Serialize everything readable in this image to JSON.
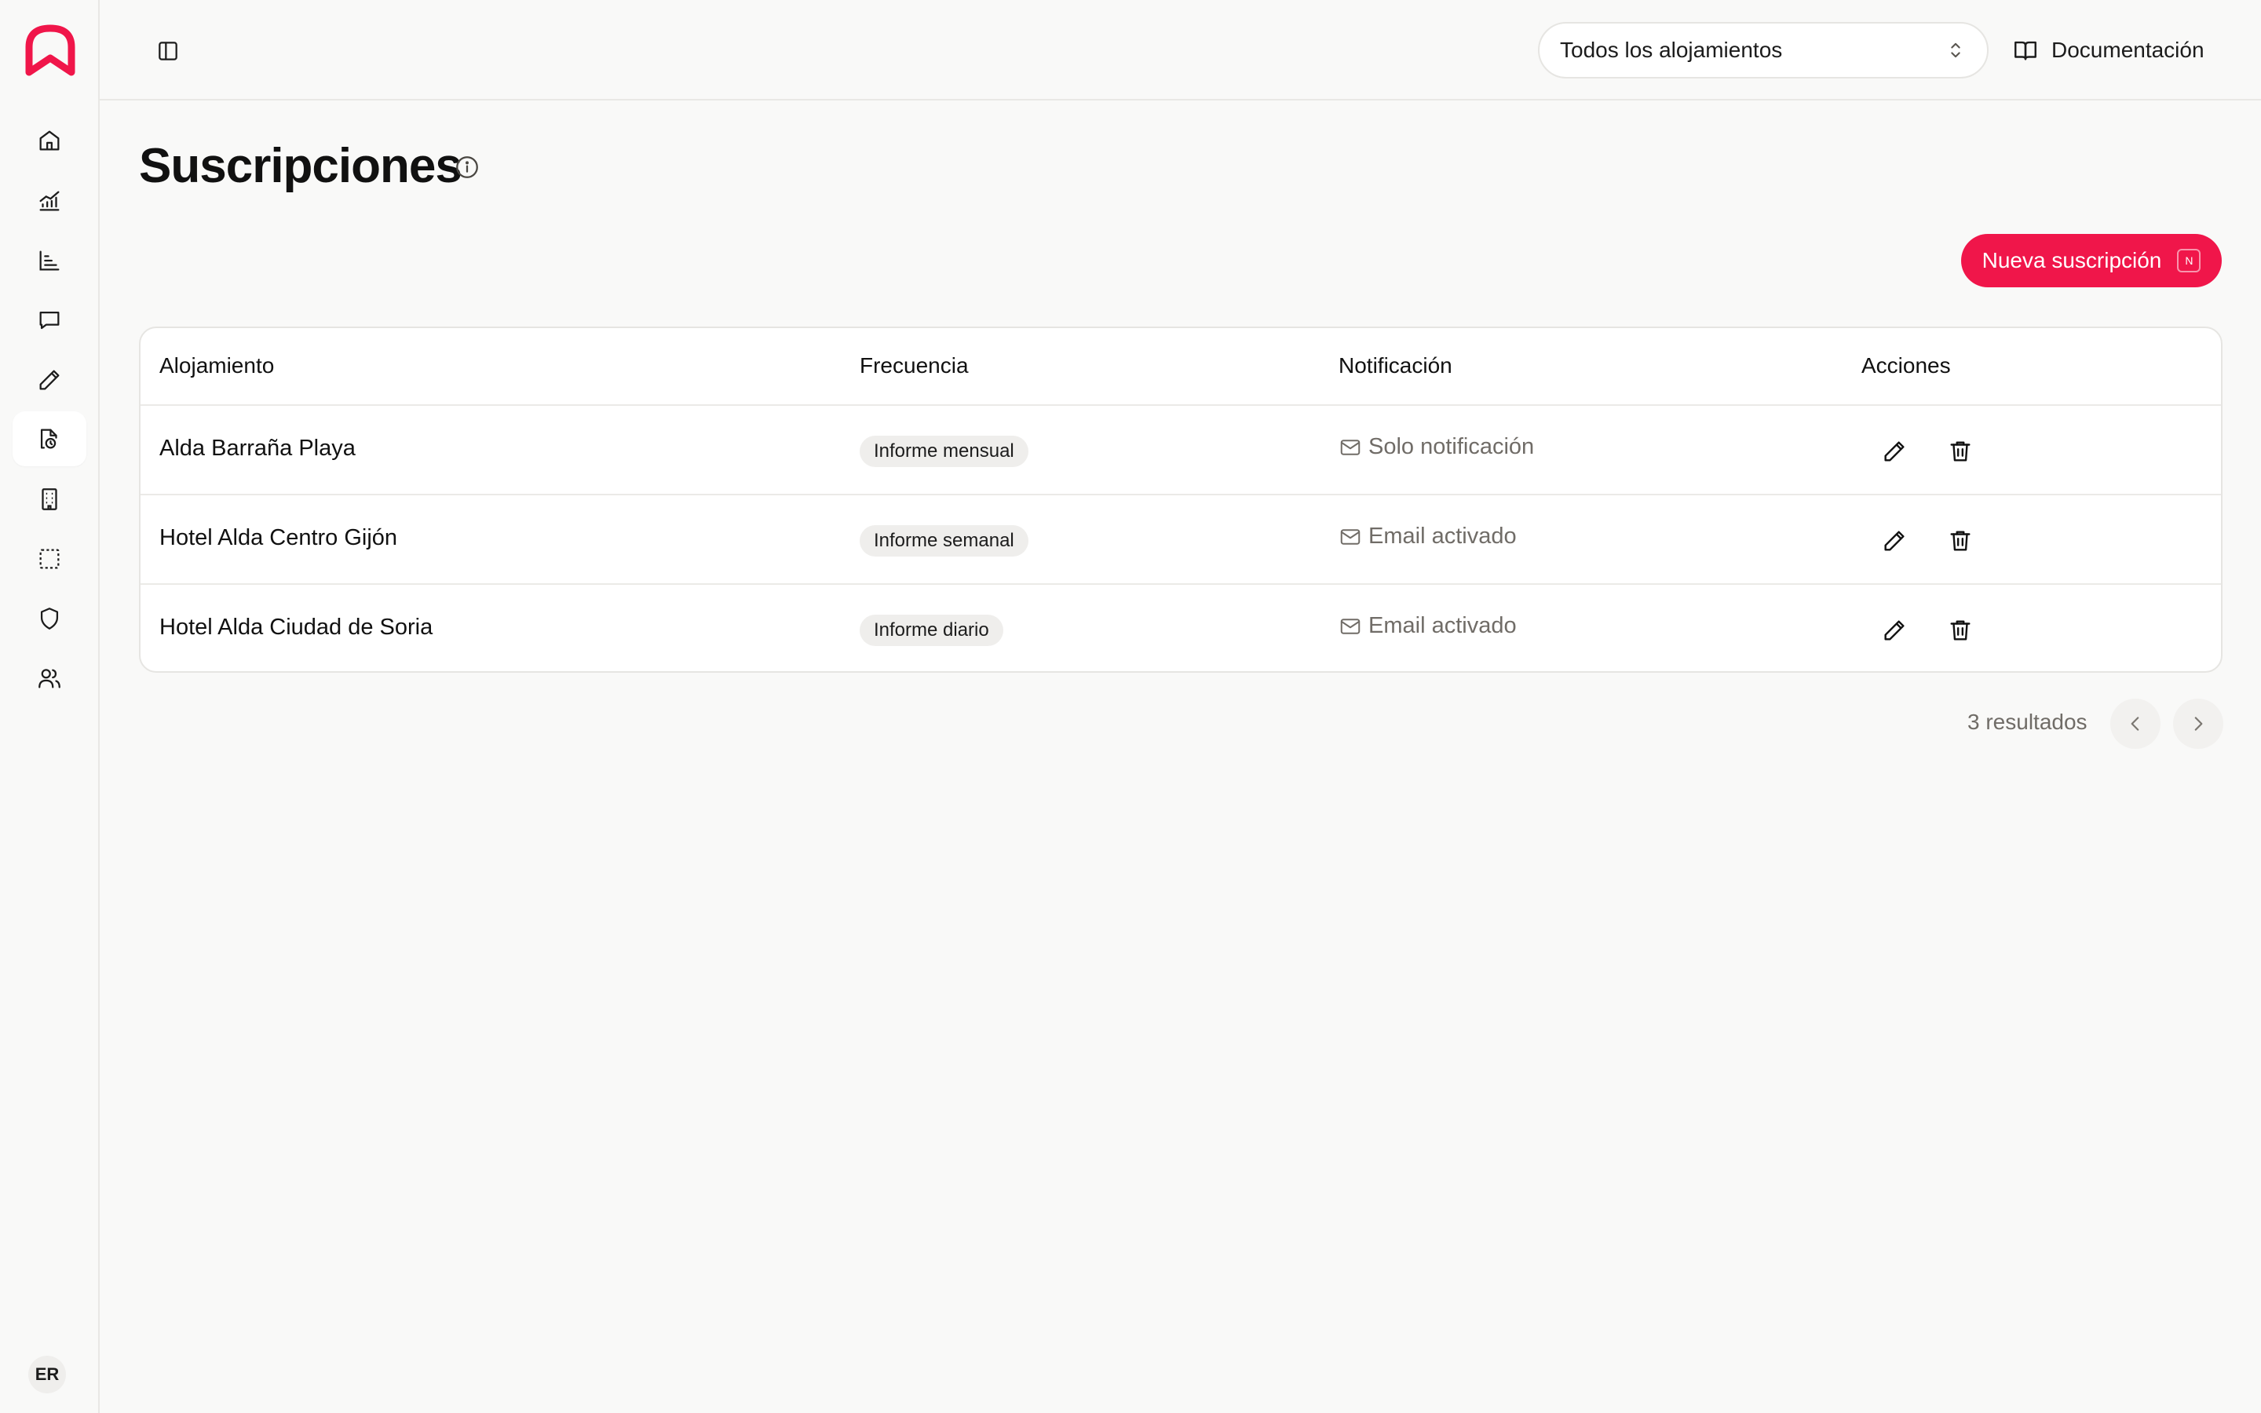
{
  "app": {
    "brand_color": "#f0164a",
    "user_initials": "ER"
  },
  "sidebar": {
    "items": [
      {
        "icon": "home-icon",
        "active": false
      },
      {
        "icon": "analytics-chart-icon",
        "active": false
      },
      {
        "icon": "bar-chart-icon",
        "active": false
      },
      {
        "icon": "message-icon",
        "active": false
      },
      {
        "icon": "pencil-icon",
        "active": false
      },
      {
        "icon": "file-clock-icon",
        "active": true
      },
      {
        "icon": "building-icon",
        "active": false
      },
      {
        "icon": "dashed-square-icon",
        "active": false
      },
      {
        "icon": "shield-icon",
        "active": false
      },
      {
        "icon": "users-icon",
        "active": false
      }
    ]
  },
  "header": {
    "property_select": "Todos los alojamientos",
    "docs_label": "Documentación"
  },
  "page": {
    "title": "Suscripciones",
    "new_button_label": "Nueva suscripción",
    "new_button_shortcut": "N"
  },
  "table": {
    "columns": [
      "Alojamiento",
      "Frecuencia",
      "Notificación",
      "Acciones"
    ],
    "rows": [
      {
        "property": "Alda Barraña Playa",
        "frequency": "Informe mensual",
        "notification": "Solo notificación"
      },
      {
        "property": "Hotel Alda Centro Gijón",
        "frequency": "Informe semanal",
        "notification": "Email activado"
      },
      {
        "property": "Hotel Alda Ciudad de Soria",
        "frequency": "Informe diario",
        "notification": "Email activado"
      }
    ]
  },
  "pagination": {
    "results_label": "3 resultados"
  }
}
